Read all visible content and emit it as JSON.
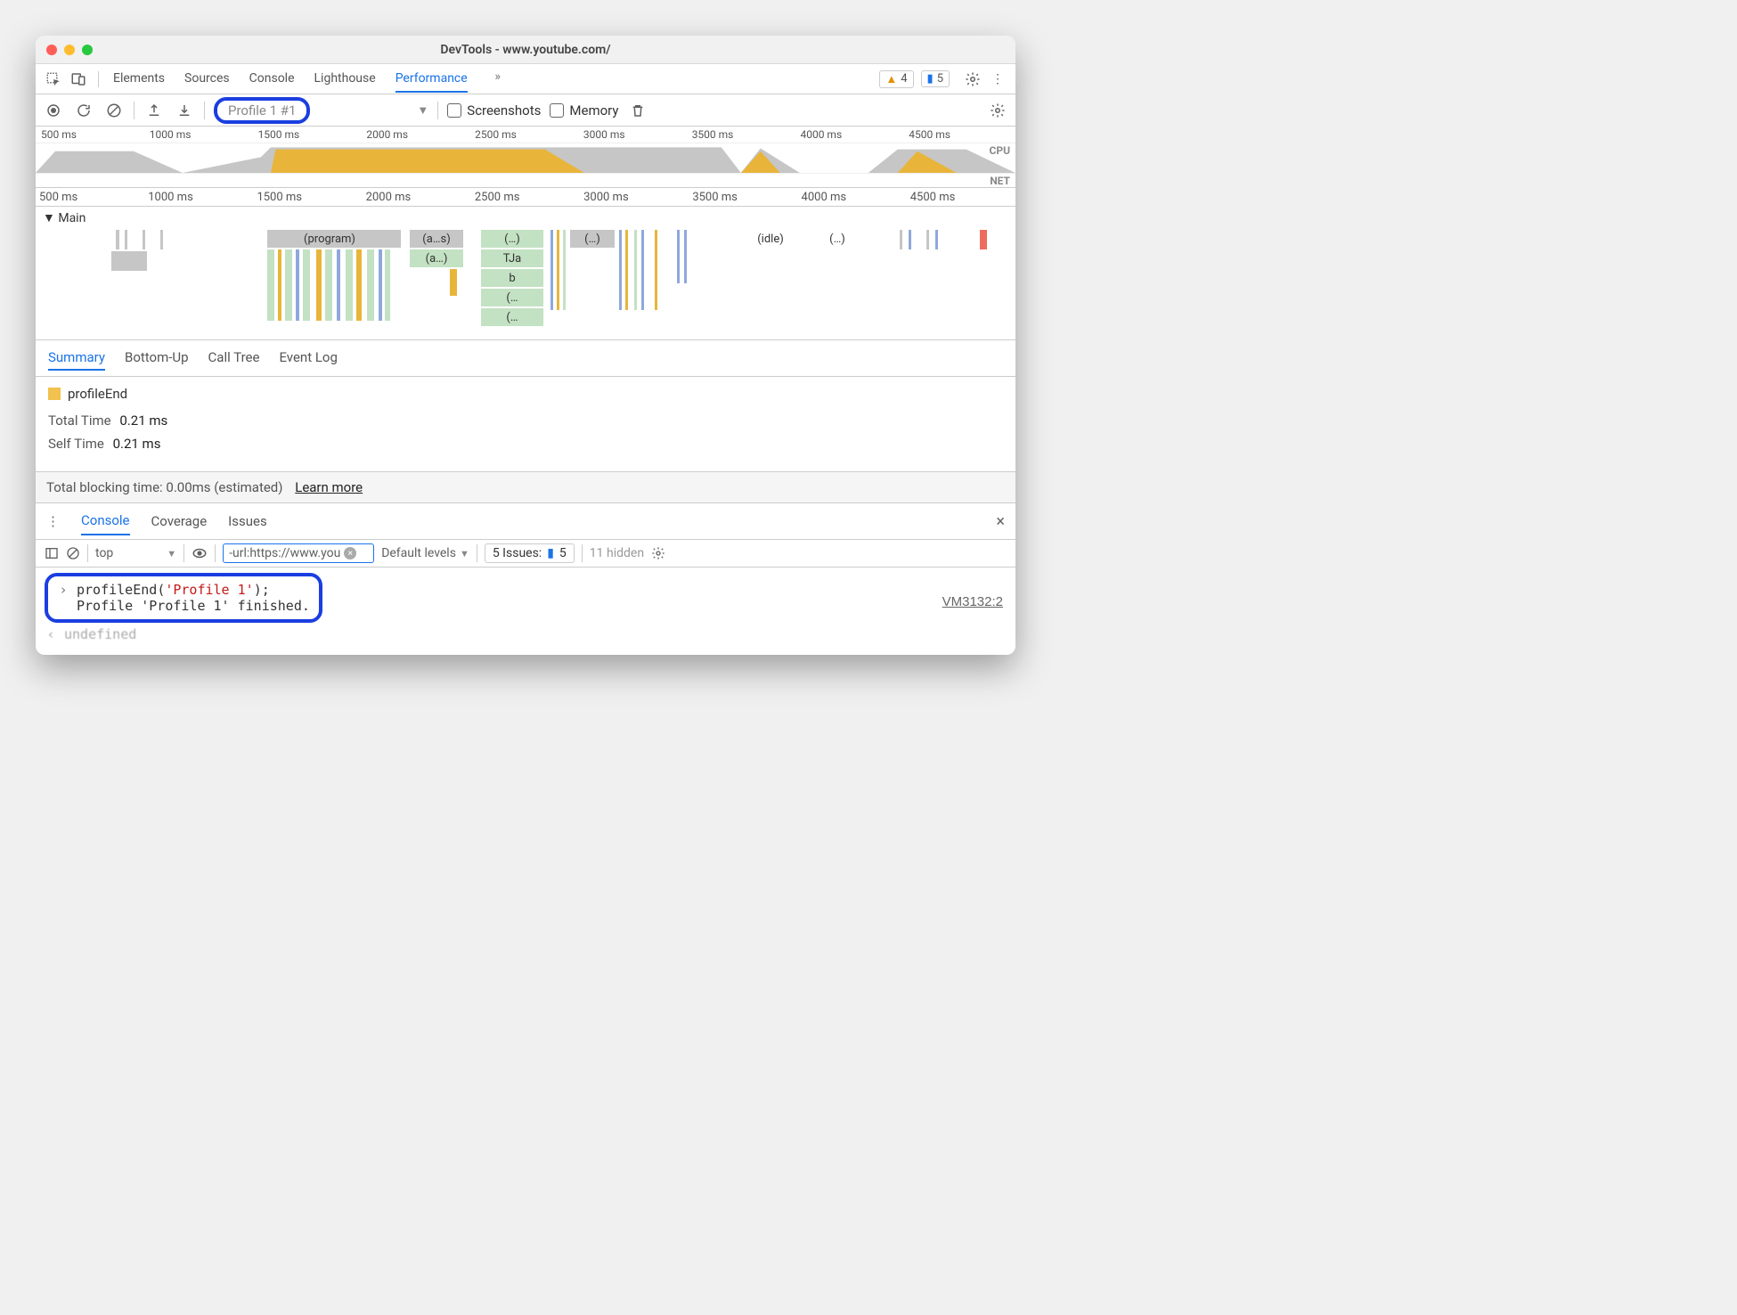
{
  "window": {
    "title": "DevTools - www.youtube.com/"
  },
  "toolbar": {
    "tabs": [
      "Elements",
      "Sources",
      "Console",
      "Lighthouse",
      "Performance"
    ],
    "active_tab": "Performance",
    "warnings": "4",
    "messages": "5"
  },
  "perf": {
    "profile_name": "Profile 1 #1",
    "screenshots_label": "Screenshots",
    "memory_label": "Memory"
  },
  "overview": {
    "ticks": [
      "500 ms",
      "1000 ms",
      "1500 ms",
      "2000 ms",
      "2500 ms",
      "3000 ms",
      "3500 ms",
      "4000 ms",
      "4500 ms"
    ],
    "cpu_label": "CPU",
    "net_label": "NET"
  },
  "detail": {
    "ticks": [
      "500 ms",
      "1000 ms",
      "1500 ms",
      "2000 ms",
      "2500 ms",
      "3000 ms",
      "3500 ms",
      "4000 ms",
      "4500 ms"
    ],
    "section_label": "Main",
    "flame_labels": {
      "program": "(program)",
      "as": "(a…s)",
      "a": "(a…)",
      "dots1": "(…)",
      "dots2": "(…)",
      "TJa": "TJa",
      "b": "b",
      "d3": "(…",
      "d4": "(…",
      "idle": "(idle)",
      "dots5": "(…)"
    }
  },
  "subtabs": {
    "items": [
      "Summary",
      "Bottom-Up",
      "Call Tree",
      "Event Log"
    ],
    "active": "Summary"
  },
  "summary": {
    "name": "profileEnd",
    "total_label": "Total Time",
    "total_value": "0.21 ms",
    "self_label": "Self Time",
    "self_value": "0.21 ms",
    "tbt_text": "Total blocking time: 0.00ms (estimated)",
    "learn_more": "Learn more"
  },
  "drawer": {
    "tabs": [
      "Console",
      "Coverage",
      "Issues"
    ],
    "active": "Console"
  },
  "console_tb": {
    "context": "top",
    "filter": "-url:https://www.you",
    "levels": "Default levels",
    "issues_label": "5 Issues:",
    "issues_count": "5",
    "hidden": "11 hidden"
  },
  "console": {
    "cmd_fn": "profileEnd",
    "cmd_arg": "'Profile 1'",
    "cmd_tail": ";",
    "result": "Profile 'Profile 1' finished.",
    "src": "VM3132:2",
    "ret": "undefined"
  }
}
